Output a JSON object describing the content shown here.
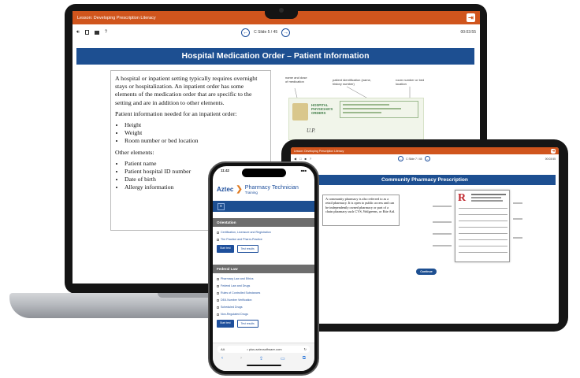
{
  "laptop": {
    "lesson_title": "Lesson: Developing Prescription Literacy",
    "toolbar": {
      "icons": [
        "speaker-icon",
        "notes-icon",
        "print-icon",
        "help-icon"
      ],
      "help_label": "?",
      "slide_label": "C Slide  5 / 45",
      "timer": "00:03:55"
    },
    "slide_title": "Hospital Medication Order – Patient Information",
    "body": {
      "intro": "A hospital or inpatient setting typically requires overnight stays or hospitalization. An inpatient order has some elements of the medication order that are specific to the setting and are in addition to other elements.",
      "patient_info_heading": "Patient information needed for an inpatient order:",
      "patient_info_items": [
        "Height",
        "Weight",
        "Room number or bed location"
      ],
      "other_heading": "Other elements:",
      "other_items": [
        "Patient name",
        "Patient hospital ID number",
        "Date of birth",
        "Allergy information"
      ]
    },
    "order_form": {
      "callout_1": "name and dose of medication",
      "callout_2": "patient identification (name, history number)",
      "callout_3": "room number or bed location",
      "form_title": "HOSPITAL PHYSICIAN'S ORDERS",
      "signature": "U.P."
    }
  },
  "tablet": {
    "lesson_title": "Lesson: Developing Prescription Literacy",
    "slide_label": "C Slide  7 / 45",
    "slide_title": "Community Pharmacy Prescription",
    "body": "A community pharmacy is also referred to as a retail pharmacy. It is open to public access and can be independently owned pharmacy or part of a chain pharmacy such CVS, Walgreens, or Rite Aid.",
    "rx_symbol": "R",
    "continue_label": "Continue"
  },
  "phone": {
    "time": "11:42",
    "brand": "Aztec",
    "app_title": "Pharmacy Technician",
    "app_subtitle": "Training",
    "section_1": {
      "title": "Orientation",
      "links": [
        "Certification, Licensure and Registration",
        "The Practice and Pharm-Practice"
      ],
      "btn_primary": "Start test",
      "btn_secondary": "Test results"
    },
    "section_2": {
      "title": "Federal Law",
      "links": [
        "Pharmacy Law and Ethics",
        "Federal Law and Drugs",
        "Rules of Controlled Substances",
        "DEA Number Verification",
        "Scheduled Drugs",
        "Non-Regulated Drugs"
      ],
      "btn_primary": "Start test",
      "btn_secondary": "Test results"
    },
    "browser": {
      "aa": "AA",
      "url": "• plus.aztecsoftware.com",
      "reload": "↻"
    }
  },
  "colors": {
    "lesson_bar": "#d0551d",
    "title_bar": "#1d4f91",
    "link_blue": "#1e4f9c"
  }
}
